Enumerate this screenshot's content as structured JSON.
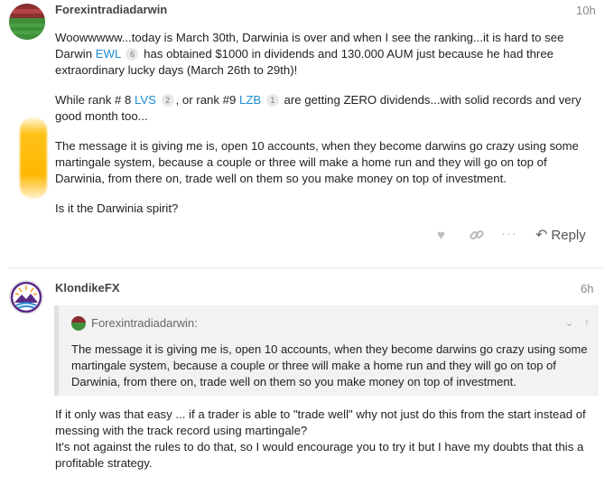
{
  "post1": {
    "username": "Forexintradiadarwin",
    "time": "10h",
    "p1_a": "Woowwwww...today is March 30th, Darwinia is over and when I see the ranking...it is hard to see Darwin",
    "p1_link": "EWL",
    "p1_badge": "6",
    "p1_b": "has obtained $1000 in dividends and 130.000 AUM just because he had three extraordinary lucky days (March 26th to 29th)!",
    "p2_a": "While rank # 8",
    "p2_link1": "LVS",
    "p2_badge1": "2",
    "p2_b": ", or rank #9",
    "p2_link2": "LZB",
    "p2_badge2": "1",
    "p2_c": "are getting ZERO dividends...with solid records and very good month too...",
    "p3": "The message it is giving me is, open 10 accounts, when they become darwins go crazy using some martingale system, because a couple or three will make a home run and they will go on top of Darwinia, from there on, trade well on them so you make money on top of investment.",
    "p4": "Is it the Darwinia spirit?",
    "reply_label": "Reply",
    "icons": [
      "heart-icon",
      "link-icon",
      "more-icon",
      "reply-icon"
    ]
  },
  "post2": {
    "username": "KlondikeFX",
    "time": "6h",
    "quote_author": "Forexintradiadarwin:",
    "quote_text": "The message it is giving me is, open 10 accounts, when they become darwins go crazy using some martingale system, because a couple or three will make a home run and they will go on top of Darwinia, from there on, trade well on them so you make money on top of investment.",
    "p1": "If it only was that easy ... if a trader is able to \"trade well\" why not just do this from the start instead of messing with the track record using martingale?",
    "p2": "It's not against the rules to do that, so I would encourage you to try it but I have my doubts that this a profitable strategy."
  },
  "colors": {
    "link": "#1a8ed1",
    "highlight": "#ffb700",
    "quote_bg": "#f2f2f2"
  }
}
